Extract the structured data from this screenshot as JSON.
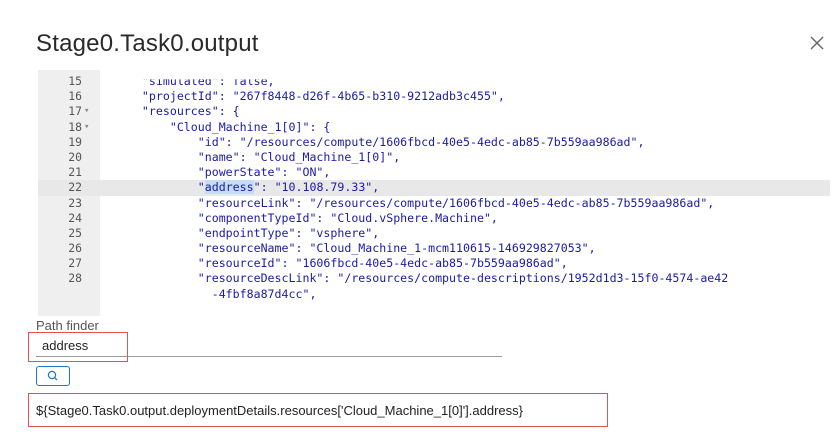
{
  "dialog": {
    "title": "Stage0.Task0.output"
  },
  "editor": {
    "lines": [
      {
        "n": "15",
        "fold": "",
        "text": "    \"simulated\": false,",
        "partial": true
      },
      {
        "n": "16",
        "fold": "",
        "text": "    \"projectId\": \"267f8448-d26f-4b65-b310-9212adb3c455\","
      },
      {
        "n": "17",
        "fold": "▾",
        "text": "    \"resources\": {"
      },
      {
        "n": "18",
        "fold": "▾",
        "text": "        \"Cloud_Machine_1[0]\": {"
      },
      {
        "n": "19",
        "fold": "",
        "text": "            \"id\": \"/resources/compute/1606fbcd-40e5-4edc-ab85-7b559aa986ad\","
      },
      {
        "n": "20",
        "fold": "",
        "text": "            \"name\": \"Cloud_Machine_1[0]\","
      },
      {
        "n": "21",
        "fold": "",
        "text": "            \"powerState\": \"ON\","
      },
      {
        "n": "22",
        "fold": "",
        "pre": "            \"",
        "hl": "address",
        "post": "\": \"10.108.79.33\",",
        "active": true
      },
      {
        "n": "23",
        "fold": "",
        "text": "            \"resourceLink\": \"/resources/compute/1606fbcd-40e5-4edc-ab85-7b559aa986ad\","
      },
      {
        "n": "24",
        "fold": "",
        "text": "            \"componentTypeId\": \"Cloud.vSphere.Machine\","
      },
      {
        "n": "25",
        "fold": "",
        "text": "            \"endpointType\": \"vsphere\","
      },
      {
        "n": "26",
        "fold": "",
        "text": "            \"resourceName\": \"Cloud_Machine_1-mcm110615-146929827053\","
      },
      {
        "n": "27",
        "fold": "",
        "text": "            \"resourceId\": \"1606fbcd-40e5-4edc-ab85-7b559aa986ad\","
      },
      {
        "n": "28",
        "fold": "",
        "text": "            \"resourceDescLink\": \"/resources/compute-descriptions/1952d1d3-15f0-4574-ae42"
      },
      {
        "n": "",
        "fold": "",
        "text": "              -4fbf8a87d4cc\","
      }
    ]
  },
  "path_finder": {
    "label": "Path finder",
    "value": "address",
    "result": "${Stage0.Task0.output.deploymentDetails.resources['Cloud_Machine_1[0]'].address}"
  },
  "icons": {
    "close": "close-icon",
    "search": "search-icon"
  },
  "colors": {
    "highlight_box": "#e0534e",
    "button_border": "#1f77c8",
    "code_text": "#1a1aa6",
    "selection": "#c6dcf5"
  }
}
